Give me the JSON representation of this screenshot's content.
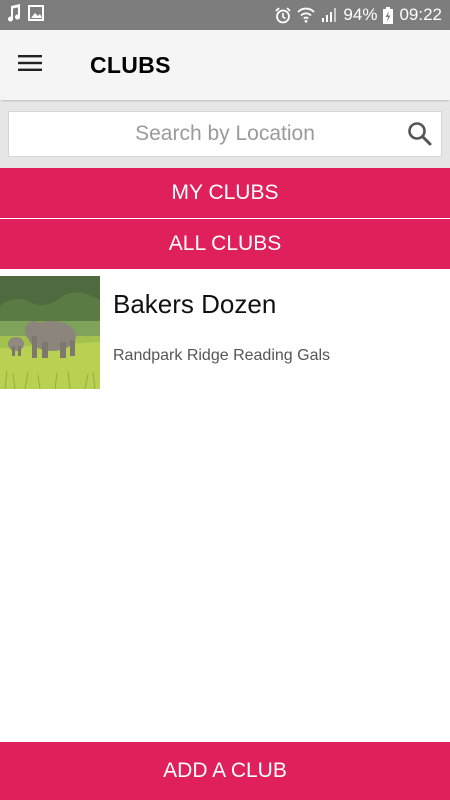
{
  "status_bar": {
    "battery": "94%",
    "time": "09:22",
    "left_icons": [
      "music-note-icon",
      "image-icon"
    ],
    "right_icons": [
      "alarm-icon",
      "wifi-icon",
      "signal-icon",
      "battery-charging-icon"
    ]
  },
  "app_bar": {
    "title": "CLUBS",
    "menu_icon": "hamburger-menu-icon"
  },
  "search": {
    "placeholder": "Search by Location",
    "value": ""
  },
  "tabs": {
    "my_clubs": "MY CLUBS",
    "all_clubs": "ALL CLUBS"
  },
  "clubs": [
    {
      "name": "Bakers Dozen",
      "subtitle": "Randpark Ridge Reading Gals",
      "thumbnail": "elephants-photo"
    }
  ],
  "footer": {
    "add_label": "ADD A CLUB"
  },
  "colors": {
    "accent": "#e0205a",
    "status_bar": "#7d7d7d",
    "app_bar": "#f5f5f5"
  }
}
